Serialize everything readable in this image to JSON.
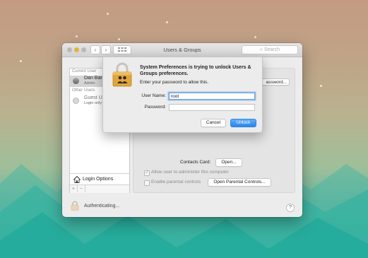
{
  "window": {
    "title": "Users & Groups",
    "search_placeholder": "Search",
    "nav_back": "‹",
    "nav_forward": "›",
    "grid_icon": "grid-icon"
  },
  "sidebar": {
    "current_user_label": "Current User",
    "current_user": {
      "name": "Dan Barb",
      "role": "Admin"
    },
    "other_users_label": "Other Users",
    "other_user": {
      "name": "Guest U",
      "role": "Login only"
    },
    "login_options": "Login Options",
    "add": "+",
    "remove": "−"
  },
  "pane": {
    "change_password": "assword...",
    "contacts_card_label": "Contacts Card:",
    "open_button": "Open...",
    "allow_admin_label": "Allow user to administer this computer",
    "allow_admin_checked": true,
    "parental_label": "Enable parental controls",
    "parental_checked": false,
    "open_parental_button": "Open Parental Controls..."
  },
  "footer": {
    "status": "Authenticating...",
    "help": "?"
  },
  "dialog": {
    "title": "System Preferences is trying to unlock Users & Groups preferences.",
    "subtitle": "Enter your password to allow this.",
    "username_label": "User Name:",
    "username_value": "root",
    "password_label": "Password:",
    "password_value": "",
    "cancel": "Cancel",
    "unlock": "Unlock"
  },
  "colors": {
    "accent": "#2b83ea",
    "lock_gold": "#e2a53a"
  }
}
